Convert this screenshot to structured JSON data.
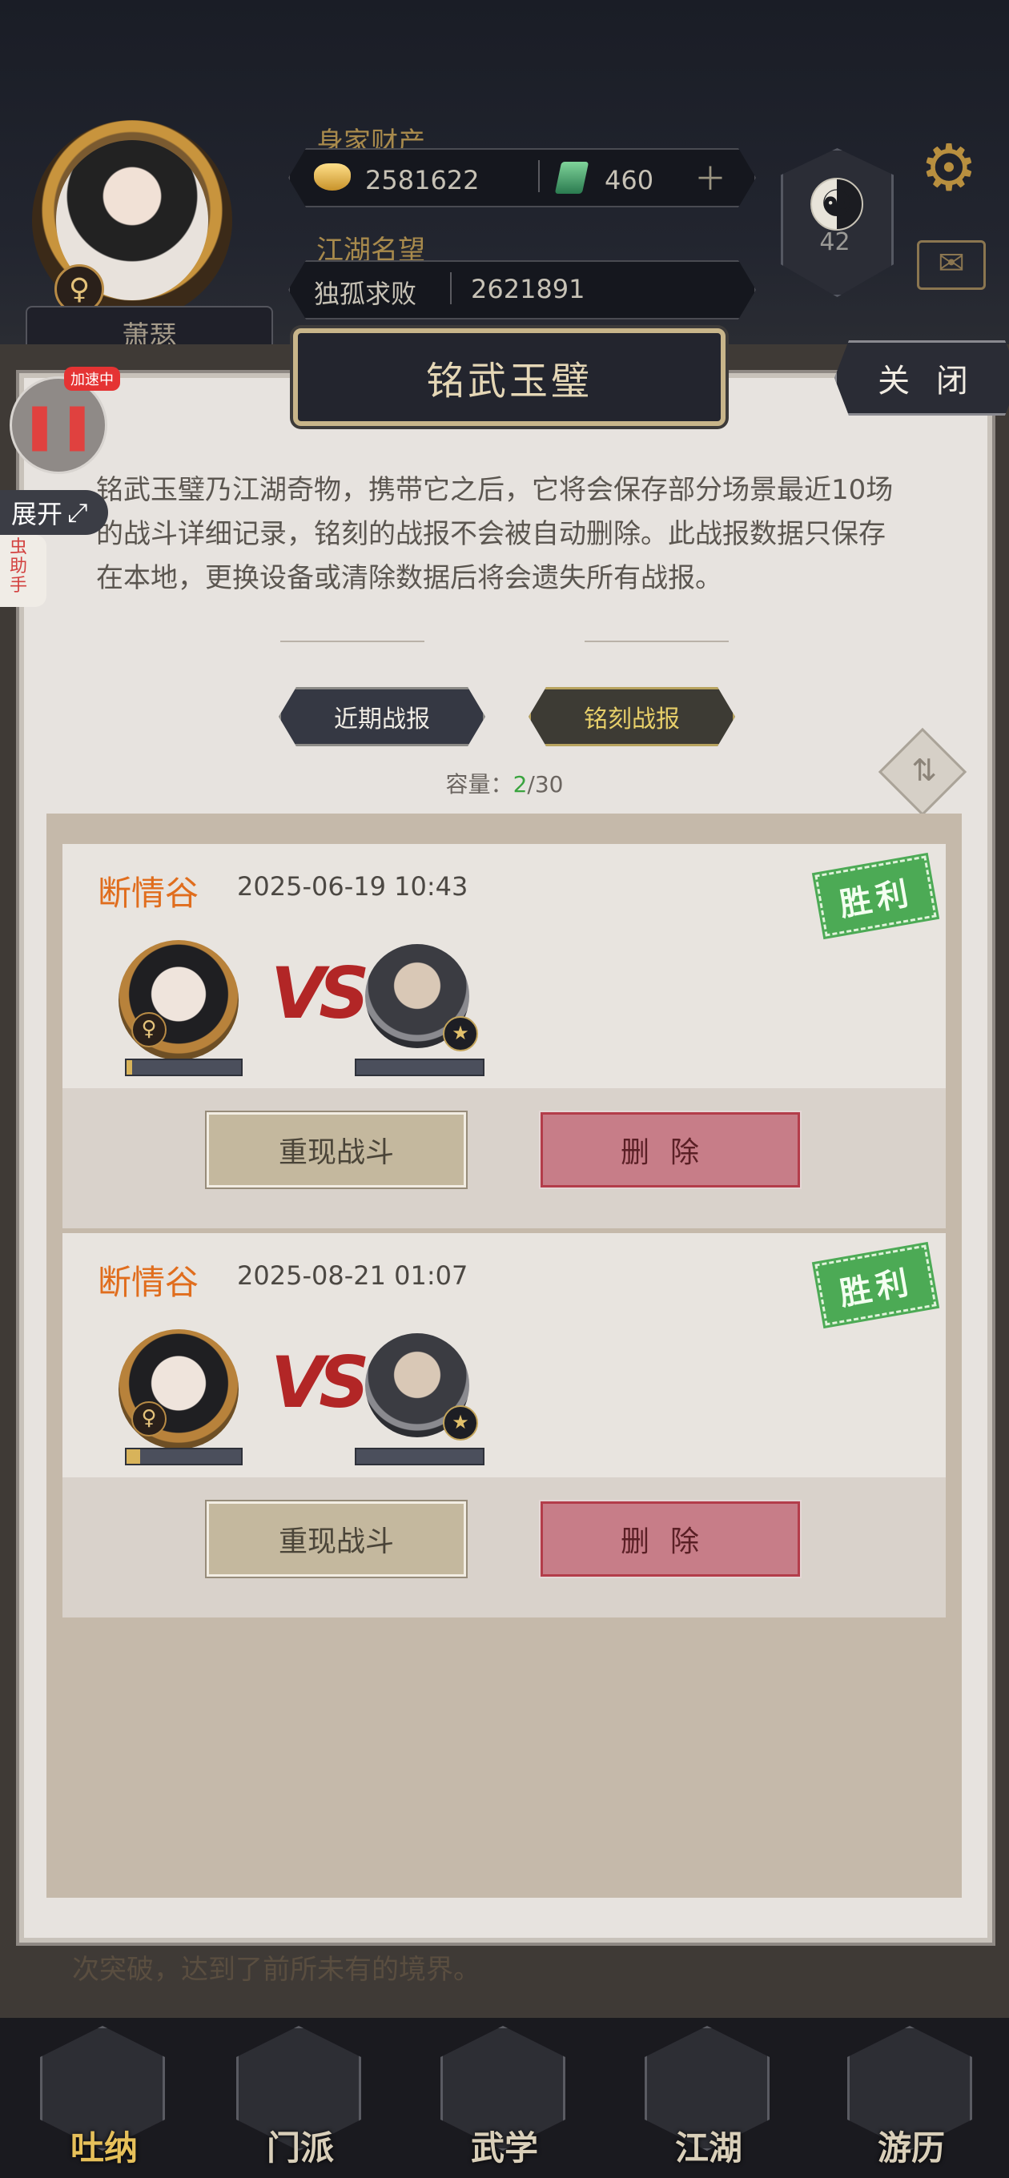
{
  "player": {
    "name": "萧瑟",
    "gender_symbol": "♀"
  },
  "assets": {
    "label": "身家财产",
    "gold": "2581622",
    "jade": "460"
  },
  "reputation": {
    "label": "江湖名望",
    "title": "独孤求败",
    "value": "2621891"
  },
  "taiji_badge": {
    "level": "42"
  },
  "helper": {
    "speed_tag": "加速中",
    "expand_label": "展开",
    "tab_label": "虫\n助\n手"
  },
  "dialog": {
    "title": "铭武玉璧",
    "close_label": "关 闭",
    "description": "铭武玉璧乃江湖奇物，携带它之后，它将会保存部分场景最近10场的战斗详细记录，铭刻的战报不会被自动删除。此战报数据只保存在本地，更换设备或清除数据后将会遗失所有战报。",
    "tabs": {
      "recent": "近期战报",
      "engraved": "铭刻战报"
    },
    "capacity": {
      "label": "容量：",
      "used": "2",
      "total": "/30"
    }
  },
  "battles": [
    {
      "location": "断情谷",
      "time": "2025-06-19 10:43",
      "result": "胜利",
      "vs": "VS",
      "player_hp_fraction": 0.05,
      "replay_label": "重现战斗",
      "delete_label": "删除"
    },
    {
      "location": "断情谷",
      "time": "2025-08-21 01:07",
      "result": "胜利",
      "vs": "VS",
      "player_hp_fraction": 0.12,
      "replay_label": "重现战斗",
      "delete_label": "删除"
    }
  ],
  "background_text": "次突破，达到了前所未有的境界。",
  "nav": [
    {
      "label": "吐纳",
      "active": true
    },
    {
      "label": "门派",
      "active": false
    },
    {
      "label": "武学",
      "active": false
    },
    {
      "label": "江湖",
      "active": false
    },
    {
      "label": "游历",
      "active": false
    }
  ],
  "colors": {
    "location": "#e06d1d",
    "win_stamp": "#4caa55",
    "capacity_used": "#3aa43f",
    "delete_button": "#c77d88",
    "vs": "#b22626"
  }
}
